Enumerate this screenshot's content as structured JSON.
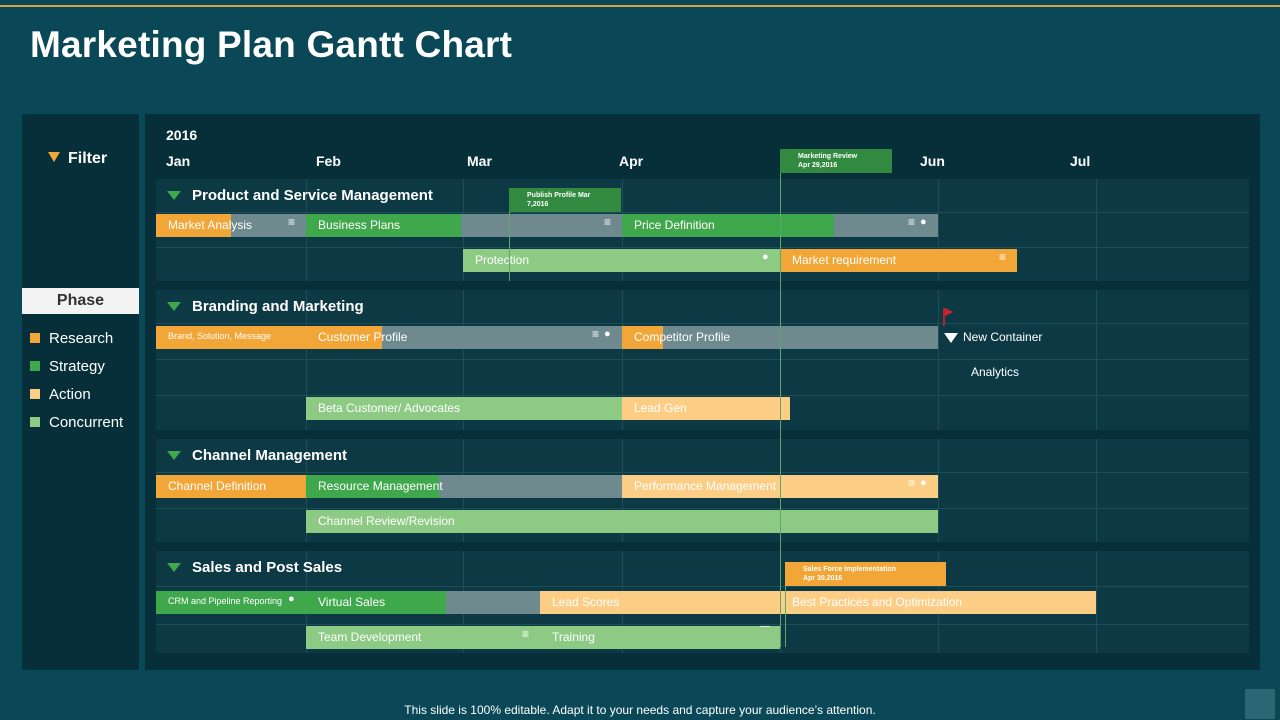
{
  "title": "Marketing Plan Gantt Chart",
  "footer": "This slide is 100% editable. Adapt it to your needs and capture your audience’s attention.",
  "colors": {
    "research": "#f3a638",
    "strategy": "#3fa84c",
    "action": "#fccd85",
    "concurrent": "#8dcb85",
    "progress_gray": "#6e8a8f"
  },
  "sidebar": {
    "filter_label": "Filter",
    "phase_label": "Phase",
    "legend": [
      {
        "label": "Research",
        "color": "#f3a638"
      },
      {
        "label": "Strategy",
        "color": "#3fa84c"
      },
      {
        "label": "Action",
        "color": "#fccd85"
      },
      {
        "label": "Concurrent",
        "color": "#8dcb85"
      }
    ]
  },
  "chart_data": {
    "type": "gantt",
    "year": "2016",
    "months": [
      "Jan",
      "Feb",
      "Mar",
      "Apr",
      "Jun",
      "Jul"
    ],
    "milestones": [
      {
        "title": "Publish Profile Mar",
        "date": "7,2016",
        "color": "#318a3f"
      },
      {
        "title": "Marketing Review",
        "date": "Apr 29,2016",
        "color": "#318a3f"
      },
      {
        "title": "Sales Force Implementation",
        "date": "Apr 30,2016",
        "color": "#f3a638"
      }
    ],
    "sections": [
      {
        "name": "Product and Service Management",
        "rows": [
          [
            {
              "label": "Market Analysis",
              "phase": "research",
              "start": "2016-01-01",
              "end": "2016-01-31",
              "progress": 0.5,
              "icons": [
                "list"
              ]
            },
            {
              "label": "Business Plans",
              "phase": "strategy",
              "start": "2016-02-01",
              "end": "2016-03-31",
              "progress": 0.49,
              "icons": [
                "list"
              ]
            },
            {
              "label": "Price Definition",
              "phase": "strategy",
              "start": "2016-04-01",
              "end": "2016-05-31",
              "progress": 0.67,
              "icons": [
                "list",
                "comment"
              ]
            }
          ],
          [
            {
              "label": "Protection",
              "phase": "concurrent",
              "start": "2016-03-01",
              "end": "2016-04-30",
              "progress": 1,
              "icons": [
                "comment"
              ]
            },
            {
              "label": "Market requirement",
              "phase": "research",
              "start": "2016-05-01",
              "end": "2016-06-15",
              "progress": 1,
              "icons": [
                "list"
              ]
            }
          ]
        ]
      },
      {
        "name": "Branding and Marketing",
        "rows": [
          [
            {
              "label": "Brand, Solution, Message",
              "phase": "research",
              "start": "2016-01-01",
              "end": "2016-01-31",
              "progress": 1,
              "icons": []
            },
            {
              "label": "Customer Profile",
              "phase": "research",
              "start": "2016-02-01",
              "end": "2016-03-31",
              "progress": 0.24,
              "icons": [
                "list",
                "comment"
              ]
            },
            {
              "label": "Competitor Profile",
              "phase": "research",
              "start": "2016-04-01",
              "end": "2016-05-31",
              "progress": 0.13,
              "icons": []
            },
            {
              "label": "New Container",
              "phase": "strategy",
              "start": "2016-06-01",
              "end": "2016-07-25",
              "progress": 1,
              "icons": [
                "dropdown"
              ],
              "flag": true
            }
          ],
          [
            {
              "label": "Analytics",
              "phase": "concurrent",
              "start": "2016-06-05",
              "end": "2016-07-15",
              "progress": 1,
              "icons": []
            }
          ],
          [
            {
              "label": "Beta Customer/ Advocates",
              "phase": "concurrent",
              "start": "2016-02-01",
              "end": "2016-03-31",
              "progress": 1,
              "icons": []
            },
            {
              "label": "Lead Gen",
              "phase": "action",
              "start": "2016-04-01",
              "end": "2016-05-02",
              "progress": 1,
              "icons": []
            }
          ]
        ]
      },
      {
        "name": "Channel Management",
        "rows": [
          [
            {
              "label": "Channel Definition",
              "phase": "research",
              "start": "2016-01-01",
              "end": "2016-01-31",
              "progress": 1,
              "icons": []
            },
            {
              "label": "Resource Management",
              "phase": "strategy",
              "start": "2016-02-01",
              "end": "2016-03-31",
              "progress": 0.42,
              "icons": []
            },
            {
              "label": "Performance Management",
              "phase": "action",
              "start": "2016-04-01",
              "end": "2016-05-31",
              "progress": 1,
              "icons": [
                "list",
                "comment"
              ]
            }
          ],
          [
            {
              "label": "Channel Review/Revision",
              "phase": "concurrent",
              "start": "2016-02-01",
              "end": "2016-05-31",
              "progress": 1,
              "icons": []
            }
          ]
        ]
      },
      {
        "name": "Sales and Post Sales",
        "rows": [
          [
            {
              "label": "CRM and Pipeline Reporting",
              "phase": "strategy",
              "start": "2016-01-01",
              "end": "2016-01-31",
              "progress": 1,
              "icons": [
                "comment"
              ]
            },
            {
              "label": "Virtual Sales",
              "phase": "strategy",
              "start": "2016-02-01",
              "end": "2016-03-15",
              "progress": 0.6,
              "icons": []
            },
            {
              "label": "Lead Scores",
              "phase": "action",
              "start": "2016-03-16",
              "end": "2016-04-30",
              "progress": 1,
              "icons": []
            },
            {
              "label": "Best Practices and Optimization",
              "phase": "action",
              "start": "2016-05-01",
              "end": "2016-06-30",
              "progress": 1,
              "icons": []
            }
          ],
          [
            {
              "label": "Team Development",
              "phase": "concurrent",
              "start": "2016-02-01",
              "end": "2016-03-15",
              "progress": 1,
              "icons": [
                "list"
              ]
            },
            {
              "label": "Training",
              "phase": "concurrent",
              "start": "2016-03-16",
              "end": "2016-04-30",
              "progress": 1,
              "icons": [
                "minus"
              ]
            }
          ]
        ]
      }
    ]
  }
}
